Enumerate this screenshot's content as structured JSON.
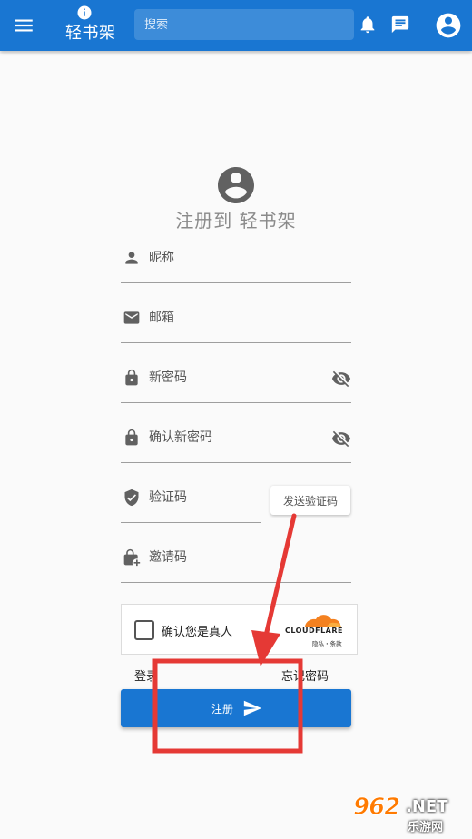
{
  "colors": {
    "primary": "#1976d2",
    "annotation": "#e53935",
    "watermark": "#ff7a00"
  },
  "appbar": {
    "title": "轻书架",
    "search_placeholder": "搜索",
    "icons": [
      "menu-icon",
      "info-icon",
      "bell-icon",
      "chat-icon",
      "account-circle-icon"
    ]
  },
  "register": {
    "title": "注册到 轻书架",
    "fields": {
      "nickname": {
        "placeholder": "昵称",
        "icon": "person-icon"
      },
      "email": {
        "placeholder": "邮箱",
        "icon": "mail-icon"
      },
      "new_password": {
        "placeholder": "新密码",
        "icon": "lock-icon"
      },
      "confirm_password": {
        "placeholder": "确认新密码",
        "icon": "lock-icon"
      },
      "code": {
        "placeholder": "验证码",
        "icon": "shield-check-icon"
      },
      "invite": {
        "placeholder": "邀请码",
        "icon": "lock-plus-icon"
      }
    },
    "send_code_label": "发送验证码",
    "captcha": {
      "label": "确认您是真人",
      "brand": "CLOUDFLARE",
      "privacy": "隐私",
      "separator": "·",
      "terms": "条款"
    },
    "login_link": "登录",
    "forgot_link": "忘记密码",
    "submit_label": "注册"
  },
  "watermark": {
    "number": "962",
    "suffix": ".NET",
    "subtitle": "乐游网"
  }
}
